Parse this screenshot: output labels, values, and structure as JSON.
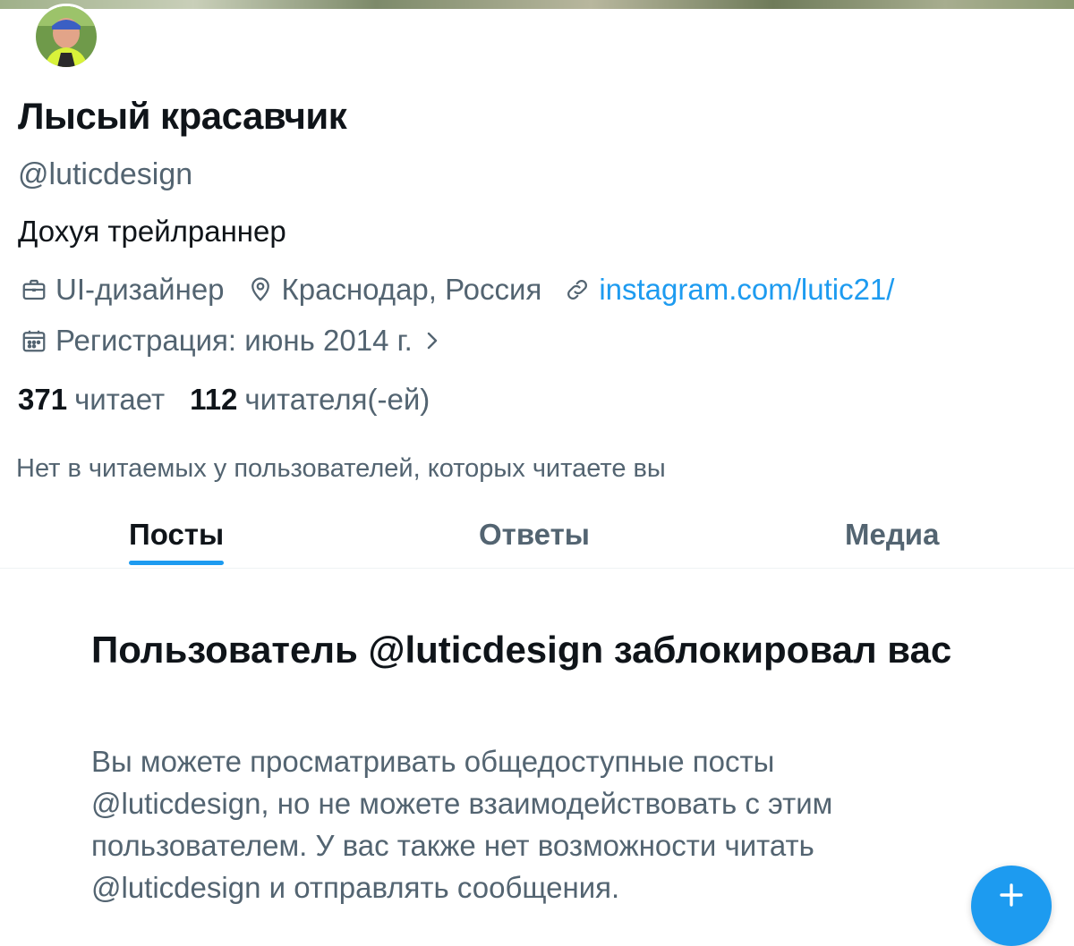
{
  "profile": {
    "display_name": "Лысый красавчик",
    "handle": "@luticdesign",
    "bio": "Дохуя трейлраннер",
    "profession": "UI-дизайнер",
    "location": "Краснодар, Россия",
    "website": "instagram.com/lutic21/",
    "joined": "Регистрация: июнь 2014 г."
  },
  "stats": {
    "following_count": "371",
    "following_label": "читает",
    "followers_count": "112",
    "followers_label": "читателя(-ей)"
  },
  "not_followed_text": "Нет в читаемых у пользователей, которых читаете вы",
  "tabs": [
    {
      "label": "Посты",
      "active": true
    },
    {
      "label": "Ответы",
      "active": false
    },
    {
      "label": "Медиа",
      "active": false
    }
  ],
  "blocked": {
    "title": "Пользователь @luticdesign заблокировал вас",
    "message": "Вы можете просматривать общедоступные посты @luticdesign, но не можете взаимодействовать с этим пользователем. У вас также нет возможности читать @luticdesign и отправлять сообщения."
  },
  "icons": {
    "profession": "briefcase-icon",
    "location": "map-pin-icon",
    "website": "link-icon",
    "joined": "calendar-icon",
    "fab": "plus-icon"
  },
  "colors": {
    "accent": "#1d9bf0",
    "text_primary": "#0f1419",
    "text_secondary": "#536471"
  }
}
